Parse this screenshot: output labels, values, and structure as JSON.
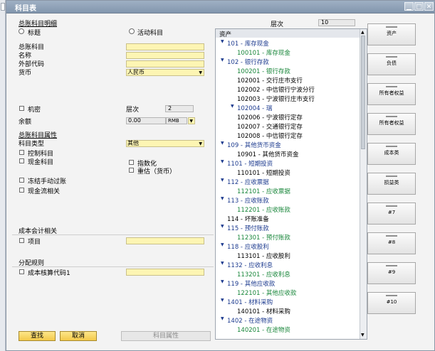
{
  "window": {
    "title": "科目表"
  },
  "left": {
    "section_title": "总账科目明细",
    "radio_title": "标题",
    "radio_active": "活动科目",
    "labels": {
      "account": "总账科目",
      "name": "名称",
      "ext_code": "外部代码",
      "currency": "货币"
    },
    "currency_value": "人民币",
    "confidential": "机密",
    "level_label": "层次",
    "level_value": "2",
    "balance_label": "余额",
    "balance_value": "0.00",
    "balance_currency": "RMB",
    "attr_title": "总账科目属性",
    "acct_type_label": "科目类型",
    "acct_type_value": "其他",
    "control_account": "控制科目",
    "cash_account": "现金科目",
    "indexed": "指数化",
    "revaluation": "重估（货币）",
    "freeze_manual": "冻结手动过账",
    "cashflow": "现金流相关",
    "cost_accounting": "成本会计相关",
    "project": "项目",
    "allocation_rule": "分配规则",
    "cost_center": "成本核算代码1"
  },
  "buttons": {
    "find": "查找",
    "cancel": "取消",
    "account_props": "科目属性"
  },
  "tree": {
    "level_label": "层次",
    "level_value": "10",
    "header": "资产",
    "items": [
      {
        "text": "101 - 库存现金",
        "expand": true,
        "indent": 0,
        "color": "dark"
      },
      {
        "text": "100101 - 库存现金",
        "indent": 1,
        "color": "grn"
      },
      {
        "text": "102 - 银行存款",
        "expand": true,
        "indent": 0,
        "color": "dark"
      },
      {
        "text": "100201 - 银行存款",
        "indent": 1,
        "color": "grn"
      },
      {
        "text": "102001 - 交行庄市支行",
        "indent": 1,
        "color": "blk"
      },
      {
        "text": "102002 - 中信银行宁波分行",
        "indent": 1,
        "color": "blk"
      },
      {
        "text": "102003 - 宁波银行庄市支行",
        "indent": 1,
        "color": "blk"
      },
      {
        "text": "102004 - 瑞",
        "expand": true,
        "indent": 1,
        "color": "dark"
      },
      {
        "text": "102006 - 宁波银行定存",
        "indent": 1,
        "color": "blk"
      },
      {
        "text": "102007 - 交通银行定存",
        "indent": 1,
        "color": "blk"
      },
      {
        "text": "102008 - 中信银行定存",
        "indent": 1,
        "color": "blk"
      },
      {
        "text": "109 - 其他货币资金",
        "expand": true,
        "indent": 0,
        "color": "dark"
      },
      {
        "text": "10901 - 其他货币资金",
        "indent": 1,
        "color": "blk"
      },
      {
        "text": "1101 - 短期投资",
        "expand": true,
        "indent": 0,
        "color": "dark"
      },
      {
        "text": "110101 - 短期投资",
        "indent": 1,
        "color": "blk"
      },
      {
        "text": "112 - 应收票据",
        "expand": true,
        "indent": 0,
        "color": "dark"
      },
      {
        "text": "112101 - 应收票据",
        "indent": 1,
        "color": "grn"
      },
      {
        "text": "113 - 应收账款",
        "expand": true,
        "indent": 0,
        "color": "dark"
      },
      {
        "text": "112201 - 应收账款",
        "indent": 1,
        "color": "grn"
      },
      {
        "text": "114 - 坏账准备",
        "indent": 0,
        "color": "blk"
      },
      {
        "text": "115 - 预付账款",
        "expand": true,
        "indent": 0,
        "color": "dark"
      },
      {
        "text": "112301 - 预付账款",
        "indent": 1,
        "color": "grn"
      },
      {
        "text": "118 - 应收股利",
        "expand": true,
        "indent": 0,
        "color": "dark"
      },
      {
        "text": "113101 - 应收股利",
        "indent": 1,
        "color": "blk"
      },
      {
        "text": "1132 - 应收利息",
        "expand": true,
        "indent": 0,
        "color": "dark"
      },
      {
        "text": "113201 - 应收利息",
        "indent": 1,
        "color": "grn"
      },
      {
        "text": "119 - 其他应收款",
        "expand": true,
        "indent": 0,
        "color": "dark"
      },
      {
        "text": "122101 - 其他应收款",
        "indent": 1,
        "color": "grn"
      },
      {
        "text": "1401 - 材料采购",
        "expand": true,
        "indent": 0,
        "color": "dark"
      },
      {
        "text": "140101 - 材料采购",
        "indent": 1,
        "color": "blk"
      },
      {
        "text": "1402 - 在途物资",
        "expand": true,
        "indent": 0,
        "color": "dark"
      },
      {
        "text": "140201 - 在途物资",
        "indent": 1,
        "color": "grn"
      }
    ]
  },
  "drawers": [
    "资产",
    "负债",
    "所有者权益",
    "所有者权益",
    "成本类",
    "损益类",
    "#7",
    "#8",
    "#9",
    "#10"
  ]
}
